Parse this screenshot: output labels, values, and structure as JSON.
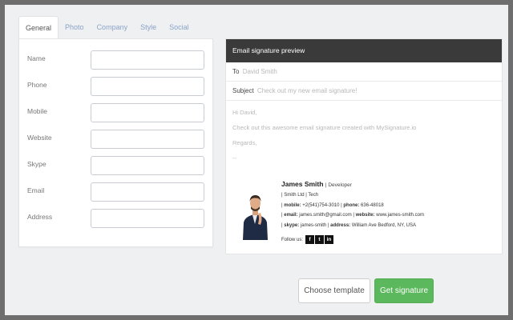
{
  "tabs": [
    {
      "label": "General",
      "active": true
    },
    {
      "label": "Photo"
    },
    {
      "label": "Company"
    },
    {
      "label": "Style"
    },
    {
      "label": "Social"
    }
  ],
  "form": {
    "fields": [
      {
        "label": "Name",
        "value": ""
      },
      {
        "label": "Phone",
        "value": ""
      },
      {
        "label": "Mobile",
        "value": ""
      },
      {
        "label": "Website",
        "value": ""
      },
      {
        "label": "Skype",
        "value": ""
      },
      {
        "label": "Email",
        "value": ""
      },
      {
        "label": "Address",
        "value": ""
      }
    ]
  },
  "preview": {
    "header": "Email signature preview",
    "to_label": "To",
    "to_value": "David Smith",
    "subject_label": "Subject",
    "subject_value": "Check out my new email signature!",
    "body": [
      "Hi David,",
      "Check out this awesome email signature created with MySignature.io",
      "Regards,",
      "--"
    ],
    "signature": {
      "name": "James Smith",
      "title": "| Developer",
      "company": "| Smith Ltd | Tech",
      "mobile_label": "mobile:",
      "mobile": "+2(541)754-3010",
      "phone_label": "phone:",
      "phone": "636-48018",
      "email_label": "email:",
      "email": "james.smith@gmail.com",
      "website_label": "website:",
      "website": "www.james-smith.com",
      "skype_label": "skype:",
      "skype": "james-smith",
      "address_label": "address:",
      "address": "William Ave Bedford, NY, USA",
      "follow_label": "Follow us:",
      "social": [
        "f",
        "t",
        "in"
      ]
    }
  },
  "buttons": {
    "choose_template": "Choose template",
    "get_signature": "Get signature"
  },
  "colors": {
    "accent_green": "#5cb85c",
    "preview_header": "#3a3a3a",
    "tab_inactive": "#8aa3c8"
  }
}
